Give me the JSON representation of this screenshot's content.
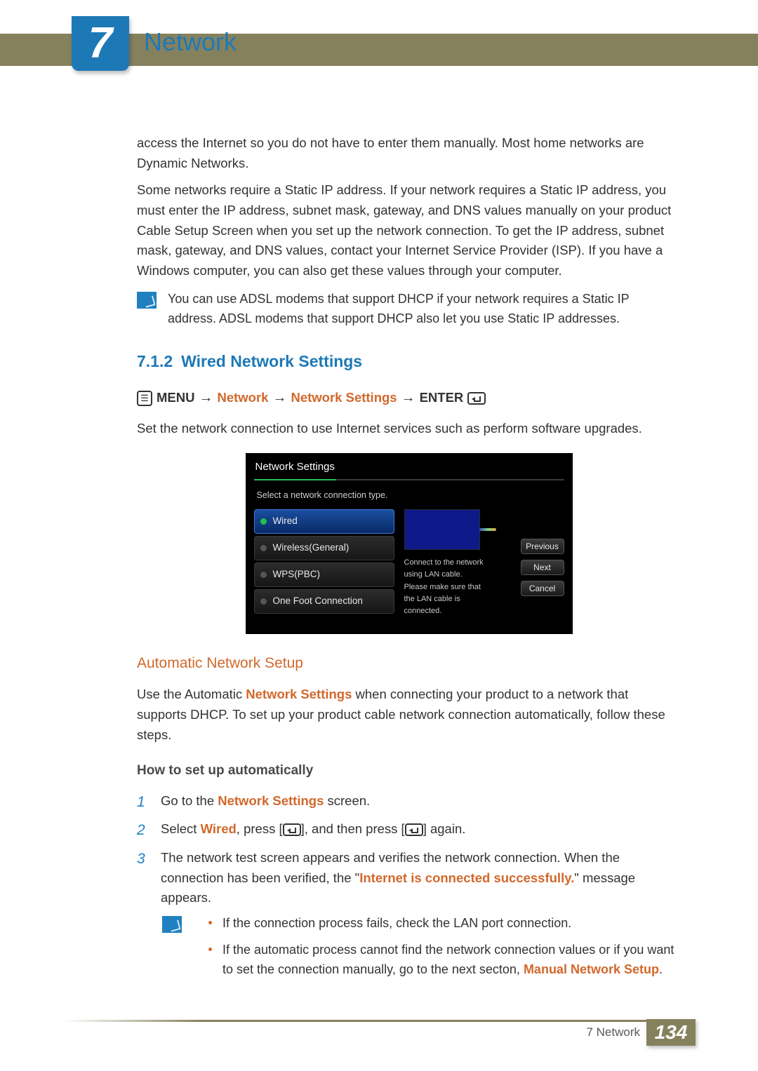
{
  "chapter": {
    "number": "7",
    "title": "Network"
  },
  "body": {
    "p1": "access the Internet so you do not have to enter them manually. Most home networks are Dynamic Networks.",
    "p2": "Some networks require a Static IP address. If your network requires a Static IP address, you must enter the IP address, subnet mask, gateway, and DNS values manually on your product Cable Setup Screen when you set up the network connection. To get the IP address, subnet mask, gateway, and DNS values, contact your Internet Service Provider (ISP). If you have a Windows computer, you can also get these values through your computer.",
    "note1": "You can use ADSL modems that support DHCP if your network requires a Static IP address. ADSL modems that support DHCP also let you use Static IP addresses."
  },
  "section": {
    "number": "7.1.2",
    "title": "Wired Network Settings"
  },
  "path": {
    "menu": "MENU",
    "p1": "Network",
    "p2": "Network Settings",
    "enter": "ENTER"
  },
  "desc_after_path": "Set the network connection to use Internet services such as perform software upgrades.",
  "screen": {
    "title": "Network Settings",
    "subtitle": "Select a network connection type.",
    "options": [
      "Wired",
      "Wireless(General)",
      "WPS(PBC)",
      "One Foot Connection"
    ],
    "help": "Connect to the network using LAN cable. Please make sure that the LAN cable is connected.",
    "buttons": {
      "prev": "Previous",
      "next": "Next",
      "cancel": "Cancel"
    }
  },
  "auto": {
    "heading": "Automatic Network Setup",
    "p1a": "Use the Automatic ",
    "p1b": "Network Settings",
    "p1c": " when connecting your product to a network that supports DHCP. To set up your product cable network connection automatically, follow these steps.",
    "howto": "How to set up automatically",
    "step1a": "Go to the ",
    "step1b": "Network Settings",
    "step1c": " screen.",
    "step2a": "Select ",
    "step2b": "Wired",
    "step2c": ", press [",
    "step2d": "], and then press [",
    "step2e": "] again.",
    "step3a": "The network test screen appears and verifies the network connection. When the connection has been verified, the \"",
    "step3b": "Internet is connected successfully.",
    "step3c": "\" message appears.",
    "note2_b1": "If the connection process fails, check the LAN port connection.",
    "note2_b2a": "If the automatic process cannot find the network connection values or if you want to set the connection manually, go to the next secton, ",
    "note2_b2b": "Manual Network Setup",
    "note2_b2c": "."
  },
  "footer": {
    "label": "7 Network",
    "page": "134"
  }
}
